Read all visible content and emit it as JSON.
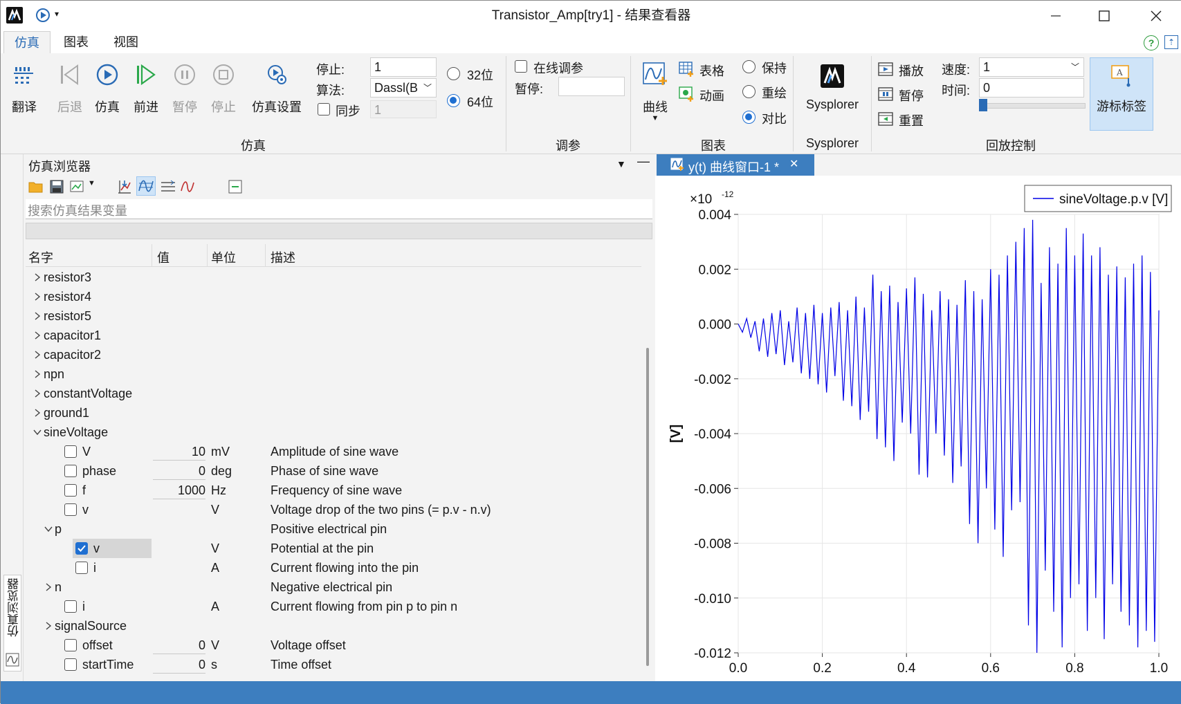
{
  "window": {
    "title": "Transistor_Amp[try1] - 结果查看器"
  },
  "menu_tabs": [
    "仿真",
    "图表",
    "视图"
  ],
  "ribbon": {
    "sim_buttons": [
      {
        "label": "翻译",
        "icon": "translate-icon"
      },
      {
        "label": "后退",
        "icon": "step-back-icon"
      },
      {
        "label": "仿真",
        "icon": "play-icon"
      },
      {
        "label": "前进",
        "icon": "step-forward-icon"
      },
      {
        "label": "暂停",
        "icon": "pause-icon"
      },
      {
        "label": "停止",
        "icon": "stop-icon"
      },
      {
        "label": "仿真设置",
        "icon": "sim-settings-icon"
      }
    ],
    "stop_label": "停止:",
    "stop_value": "1",
    "algo_label": "算法:",
    "algo_value": "Dassl(B",
    "sync_label": "同步",
    "sync_value": "1",
    "bits": [
      {
        "label": "32位",
        "selected": false
      },
      {
        "label": "64位",
        "selected": true
      }
    ],
    "group_sim": "仿真",
    "online_label": "在线调参",
    "pause_label": "暂停:",
    "group_tune": "调参",
    "curve_label": "曲线",
    "table_label": "表格",
    "anim_label": "动画",
    "keep_options": [
      {
        "label": "保持",
        "selected": false
      },
      {
        "label": "重绘",
        "selected": false
      },
      {
        "label": "对比",
        "selected": true
      }
    ],
    "group_chart": "图表",
    "sysplorer_label": "Sysplorer",
    "group_sysplorer": "Sysplorer",
    "play_label": "播放",
    "pause2_label": "暂停",
    "reset_label": "重置",
    "speed_label": "速度:",
    "speed_value": "1",
    "time_label": "时间:",
    "time_value": "0",
    "group_playback": "回放控制",
    "cursor_label": "游标标签",
    "colors": {
      "accent": "#1f6fd1",
      "status": "#3d7ebf"
    }
  },
  "browser": {
    "title": "仿真浏览器",
    "search_placeholder": "搜索仿真结果变量",
    "columns": [
      "名字",
      "值",
      "单位",
      "描述"
    ],
    "side_tab": "仿真浏览器",
    "rows": [
      {
        "indent": 0,
        "kind": "collapsed",
        "name": "resistor3"
      },
      {
        "indent": 0,
        "kind": "collapsed",
        "name": "resistor4"
      },
      {
        "indent": 0,
        "kind": "collapsed",
        "name": "resistor5"
      },
      {
        "indent": 0,
        "kind": "collapsed",
        "name": "capacitor1"
      },
      {
        "indent": 0,
        "kind": "collapsed",
        "name": "capacitor2"
      },
      {
        "indent": 0,
        "kind": "collapsed",
        "name": "npn"
      },
      {
        "indent": 0,
        "kind": "collapsed",
        "name": "constantVoltage"
      },
      {
        "indent": 0,
        "kind": "collapsed",
        "name": "ground1"
      },
      {
        "indent": 0,
        "kind": "expanded",
        "name": "sineVoltage"
      },
      {
        "indent": 1,
        "kind": "var",
        "name": "V",
        "value": "10",
        "unit": "mV",
        "desc": "Amplitude of sine wave",
        "checked": false
      },
      {
        "indent": 1,
        "kind": "var",
        "name": "phase",
        "value": "0",
        "unit": "deg",
        "desc": "Phase of sine wave",
        "checked": false
      },
      {
        "indent": 1,
        "kind": "var",
        "name": "f",
        "value": "1000",
        "unit": "Hz",
        "desc": "Frequency of sine wave",
        "checked": false
      },
      {
        "indent": 1,
        "kind": "var",
        "name": "v",
        "value": "",
        "unit": "V",
        "desc": "Voltage drop of the two pins (= p.v - n.v)",
        "checked": false
      },
      {
        "indent": 1,
        "kind": "expanded",
        "name": "p",
        "desc": "Positive electrical pin"
      },
      {
        "indent": 2,
        "kind": "var",
        "name": "v",
        "value": "",
        "unit": "V",
        "desc": "Potential at the pin",
        "checked": true
      },
      {
        "indent": 2,
        "kind": "var",
        "name": "i",
        "value": "",
        "unit": "A",
        "desc": "Current flowing into the pin",
        "checked": false
      },
      {
        "indent": 1,
        "kind": "collapsed",
        "name": "n",
        "desc": "Negative electrical pin"
      },
      {
        "indent": 1,
        "kind": "var",
        "name": "i",
        "value": "",
        "unit": "A",
        "desc": "Current flowing from pin p to pin n",
        "checked": false
      },
      {
        "indent": 1,
        "kind": "collapsed",
        "name": "signalSource"
      },
      {
        "indent": 1,
        "kind": "var",
        "name": "offset",
        "value": "0",
        "unit": "V",
        "desc": "Voltage offset",
        "checked": false
      },
      {
        "indent": 1,
        "kind": "var",
        "name": "startTime",
        "value": "0",
        "unit": "s",
        "desc": "Time offset",
        "checked": false
      }
    ]
  },
  "plot_tab": {
    "label": "y(t) 曲线窗口-1 *"
  },
  "chart_data": {
    "type": "line",
    "legend": "sineVoltage.p.v [V]",
    "legend_position": "top-right",
    "ylabel": "[V]",
    "exponent": "×10",
    "exponent_power": "-12",
    "xlim": [
      0,
      1.0
    ],
    "ylim": [
      -0.012,
      0.004
    ],
    "xticks": [
      "0.0",
      "0.2",
      "0.4",
      "0.6",
      "0.8",
      "1.0"
    ],
    "yticks": [
      "0.004",
      "0.002",
      "0.000",
      "-0.002",
      "-0.004",
      "-0.006",
      "-0.008",
      "-0.010",
      "-0.012"
    ],
    "grid": true,
    "line_color": "#0000e6",
    "series": [
      {
        "name": "sineVoltage.p.v [V]",
        "x": [
          0,
          0.01,
          0.02,
          0.03,
          0.04,
          0.05,
          0.06,
          0.07,
          0.08,
          0.09,
          0.1,
          0.11,
          0.12,
          0.13,
          0.14,
          0.15,
          0.16,
          0.17,
          0.18,
          0.19,
          0.2,
          0.21,
          0.22,
          0.23,
          0.24,
          0.25,
          0.26,
          0.27,
          0.28,
          0.29,
          0.3,
          0.31,
          0.32,
          0.33,
          0.34,
          0.35,
          0.36,
          0.37,
          0.38,
          0.39,
          0.4,
          0.41,
          0.42,
          0.43,
          0.44,
          0.45,
          0.46,
          0.47,
          0.48,
          0.49,
          0.5,
          0.51,
          0.52,
          0.53,
          0.54,
          0.55,
          0.56,
          0.57,
          0.58,
          0.59,
          0.6,
          0.61,
          0.62,
          0.63,
          0.64,
          0.65,
          0.66,
          0.67,
          0.68,
          0.69,
          0.7,
          0.71,
          0.72,
          0.73,
          0.74,
          0.75,
          0.76,
          0.77,
          0.78,
          0.79,
          0.8,
          0.81,
          0.82,
          0.83,
          0.84,
          0.85,
          0.86,
          0.87,
          0.88,
          0.89,
          0.9,
          0.91,
          0.92,
          0.93,
          0.94,
          0.95,
          0.96,
          0.97,
          0.98,
          0.99,
          1.0
        ],
        "y": [
          0,
          -0.0003,
          0.0002,
          -0.0005,
          0.0001,
          -0.001,
          0.0002,
          -0.0012,
          0.0004,
          -0.0011,
          0.0005,
          -0.0015,
          0.0001,
          -0.0014,
          0.0006,
          -0.0018,
          0.0004,
          -0.002,
          0.0007,
          -0.0022,
          0.0004,
          -0.0025,
          0.0006,
          -0.0019,
          0.0008,
          -0.0028,
          0.0005,
          -0.003,
          0.001,
          -0.0035,
          0.0006,
          -0.0032,
          0.0018,
          -0.0042,
          0.0012,
          -0.0045,
          0.0014,
          -0.005,
          0.0008,
          -0.0036,
          0.0013,
          -0.004,
          0.0017,
          -0.0055,
          0.0011,
          -0.0056,
          0.0005,
          -0.004,
          0.0012,
          -0.0048,
          0.0009,
          -0.0058,
          0.0007,
          -0.0052,
          0.0016,
          -0.0073,
          0.0012,
          -0.008,
          0.0009,
          -0.006,
          0.002,
          -0.0075,
          0.0018,
          -0.0085,
          0.0025,
          -0.0068,
          0.003,
          -0.0065,
          0.0035,
          -0.011,
          0.0038,
          -0.012,
          0.0015,
          -0.009,
          0.0028,
          -0.0105,
          0.0022,
          -0.0118,
          0.0035,
          -0.01,
          0.0025,
          -0.0095,
          0.0033,
          -0.0112,
          0.0025,
          -0.01,
          0.0028,
          -0.0115,
          0.0018,
          -0.0095,
          0.0021,
          -0.0105,
          0.0017,
          -0.011,
          0.0022,
          -0.0118,
          0.0025,
          -0.0112,
          0.0019,
          -0.0116,
          0.0005
        ]
      }
    ]
  }
}
